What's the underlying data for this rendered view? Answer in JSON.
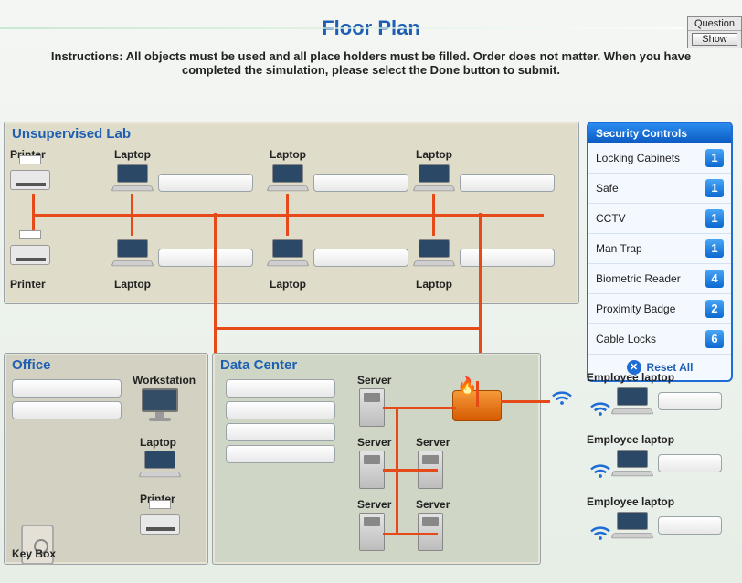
{
  "topbox": {
    "question": "Question",
    "show": "Show"
  },
  "title": "Floor Plan",
  "instructions": "Instructions: All objects must be used and all place holders must be filled. Order does not matter. When you have completed the simulation, please select the Done button to submit.",
  "zones": {
    "lab": {
      "title": "Unsupervised Lab",
      "top_row": [
        "Printer",
        "Laptop",
        "Laptop",
        "Laptop"
      ],
      "bottom_row": [
        "Printer",
        "Laptop",
        "Laptop",
        "Laptop"
      ]
    },
    "office": {
      "title": "Office",
      "items": [
        "Workstation",
        "Laptop",
        "Printer",
        "Key Box"
      ]
    },
    "dc": {
      "title": "Data Center",
      "servers": [
        "Server",
        "Server",
        "Server",
        "Server",
        "Server"
      ]
    }
  },
  "panel": {
    "title": "Security Controls",
    "rows": [
      {
        "label": "Locking Cabinets",
        "count": 1
      },
      {
        "label": "Safe",
        "count": 1
      },
      {
        "label": "CCTV",
        "count": 1
      },
      {
        "label": "Man Trap",
        "count": 1
      },
      {
        "label": "Biometric Reader",
        "count": 4
      },
      {
        "label": "Proximity Badge",
        "count": 2
      },
      {
        "label": "Cable Locks",
        "count": 6
      }
    ],
    "reset": "Reset  All"
  },
  "employees": {
    "label": "Employee laptop"
  }
}
